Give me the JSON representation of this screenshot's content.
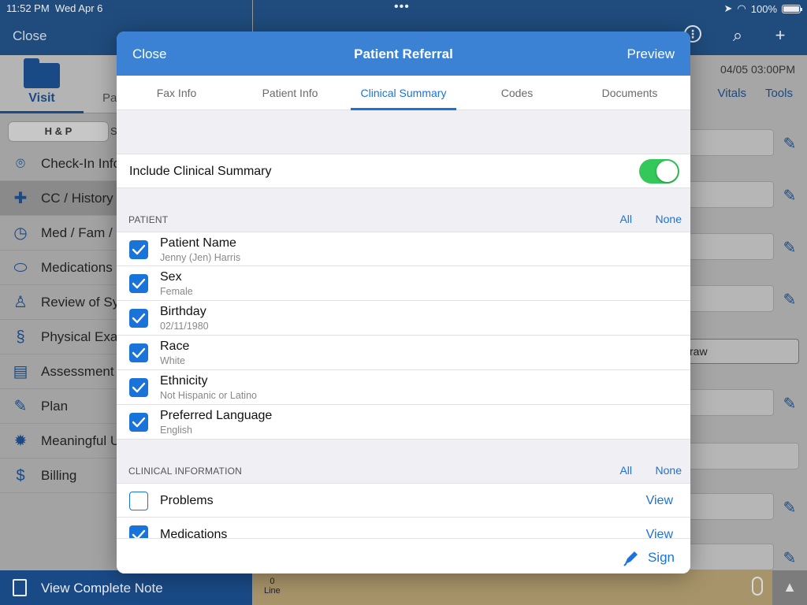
{
  "status_bar": {
    "time": "11:52 PM",
    "date": "Wed Apr 6",
    "battery": "100%"
  },
  "background": {
    "close_label": "Close",
    "visit_tab": "Visit",
    "pa_tab": "Pa",
    "hp_segment": "H & P",
    "s_segment": "S",
    "nav_items": [
      {
        "label": "Check-In Info",
        "icon": "location-pin-icon"
      },
      {
        "label": "CC / History",
        "icon": "plus-cross-icon"
      },
      {
        "label": "Med / Fam / S",
        "icon": "history-clock-icon"
      },
      {
        "label": "Medications",
        "icon": "pill-icon"
      },
      {
        "label": "Review of Sy",
        "icon": "person-icon"
      },
      {
        "label": "Physical Exar",
        "icon": "stethoscope-icon"
      },
      {
        "label": "Assessment",
        "icon": "clipboard-icon"
      },
      {
        "label": "Plan",
        "icon": "pen-icon"
      },
      {
        "label": "Meaningful U",
        "icon": "mu-badge-icon"
      },
      {
        "label": "Billing",
        "icon": "dollar-icon"
      }
    ],
    "date_time": "04/05 03:00PM",
    "links": [
      "Vitals",
      "Tools"
    ],
    "draw_label": "raw",
    "view_note": "View Complete Note",
    "line_count": "0",
    "line_label": "Line"
  },
  "modal": {
    "close": "Close",
    "title": "Patient Referral",
    "preview": "Preview",
    "tabs": [
      "Fax Info",
      "Patient Info",
      "Clinical Summary",
      "Codes",
      "Documents"
    ],
    "active_tab": "Clinical Summary",
    "include_label": "Include Clinical Summary",
    "patient_section": {
      "title": "PATIENT",
      "all": "All",
      "none": "None",
      "items": [
        {
          "name": "Patient Name",
          "value": "Jenny (Jen) Harris"
        },
        {
          "name": "Sex",
          "value": "Female"
        },
        {
          "name": "Birthday",
          "value": "02/11/1980"
        },
        {
          "name": "Race",
          "value": "White"
        },
        {
          "name": "Ethnicity",
          "value": "Not Hispanic or Latino"
        },
        {
          "name": "Preferred Language",
          "value": "English"
        }
      ]
    },
    "clinical_section": {
      "title": "CLINICAL INFORMATION",
      "all": "All",
      "none": "None",
      "items": [
        {
          "name": "Problems",
          "view": "View"
        },
        {
          "name": "Medications",
          "view": "View"
        }
      ]
    },
    "sign": "Sign"
  },
  "colors": {
    "accent": "#1a73d9",
    "header_blue": "#3b82d5",
    "toggle_green": "#34c759"
  }
}
